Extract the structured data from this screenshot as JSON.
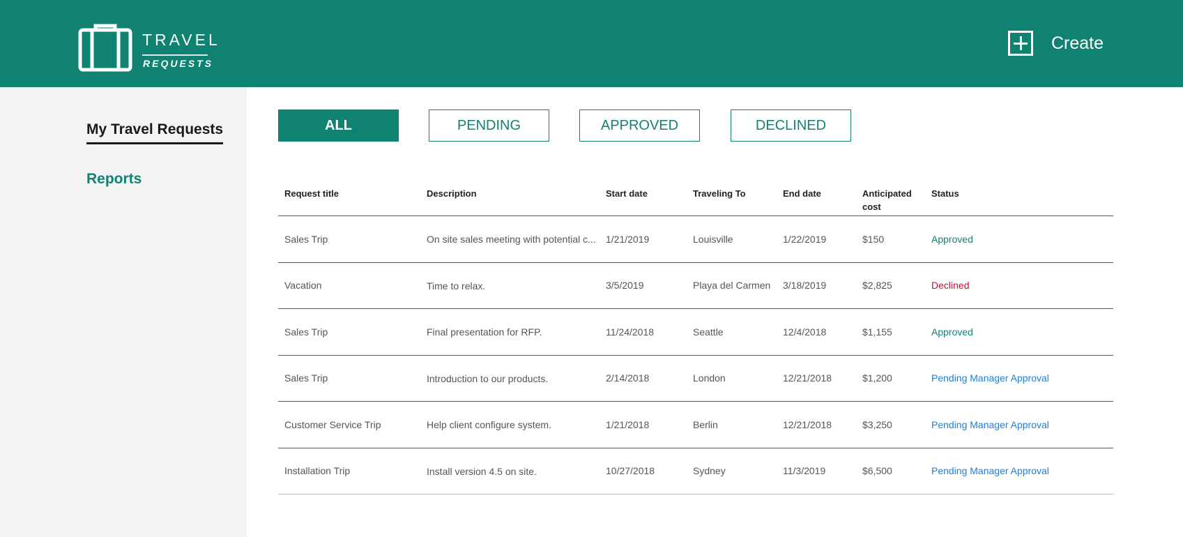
{
  "app": {
    "logo_line1": "TRAVEL",
    "logo_line2": "REQUESTS",
    "create_label": "Create"
  },
  "colors": {
    "brand": "#108272",
    "approved": "#108272",
    "declined": "#c8102e",
    "pending": "#1e7fd6"
  },
  "sidebar": {
    "items": [
      {
        "label": "My Travel Requests"
      },
      {
        "label": "Reports"
      }
    ]
  },
  "filters": [
    {
      "label": "ALL"
    },
    {
      "label": "PENDING"
    },
    {
      "label": "APPROVED"
    },
    {
      "label": "DECLINED"
    }
  ],
  "table": {
    "headers": [
      "Request title",
      "Description",
      "Start date",
      "Traveling To",
      "End date",
      "Anticipated cost",
      "Status"
    ],
    "rows": [
      {
        "title": "Sales Trip",
        "description": "On site sales meeting with potential c...",
        "start": "1/21/2019",
        "to": "Louisville",
        "end": "1/22/2019",
        "cost": "$150",
        "status": "Approved"
      },
      {
        "title": "Vacation",
        "description": "Time to relax.",
        "start": "3/5/2019",
        "to": "Playa del Carmen",
        "end": "3/18/2019",
        "cost": "$2,825",
        "status": "Declined"
      },
      {
        "title": "Sales Trip",
        "description": "Final presentation for RFP.",
        "start": "11/24/2018",
        "to": "Seattle",
        "end": "12/4/2018",
        "cost": "$1,155",
        "status": "Approved"
      },
      {
        "title": "Sales Trip",
        "description": "Introduction to our products.",
        "start": "2/14/2018",
        "to": "London",
        "end": "12/21/2018",
        "cost": "$1,200",
        "status": "Pending Manager Approval"
      },
      {
        "title": "Customer Service Trip",
        "description": "Help client configure system.",
        "start": "1/21/2018",
        "to": "Berlin",
        "end": "12/21/2018",
        "cost": "$3,250",
        "status": "Pending Manager Approval"
      },
      {
        "title": "Installation Trip",
        "description": "Install version 4.5 on site.",
        "start": "10/27/2018",
        "to": "Sydney",
        "end": "11/3/2019",
        "cost": "$6,500",
        "status": "Pending Manager Approval"
      }
    ]
  }
}
